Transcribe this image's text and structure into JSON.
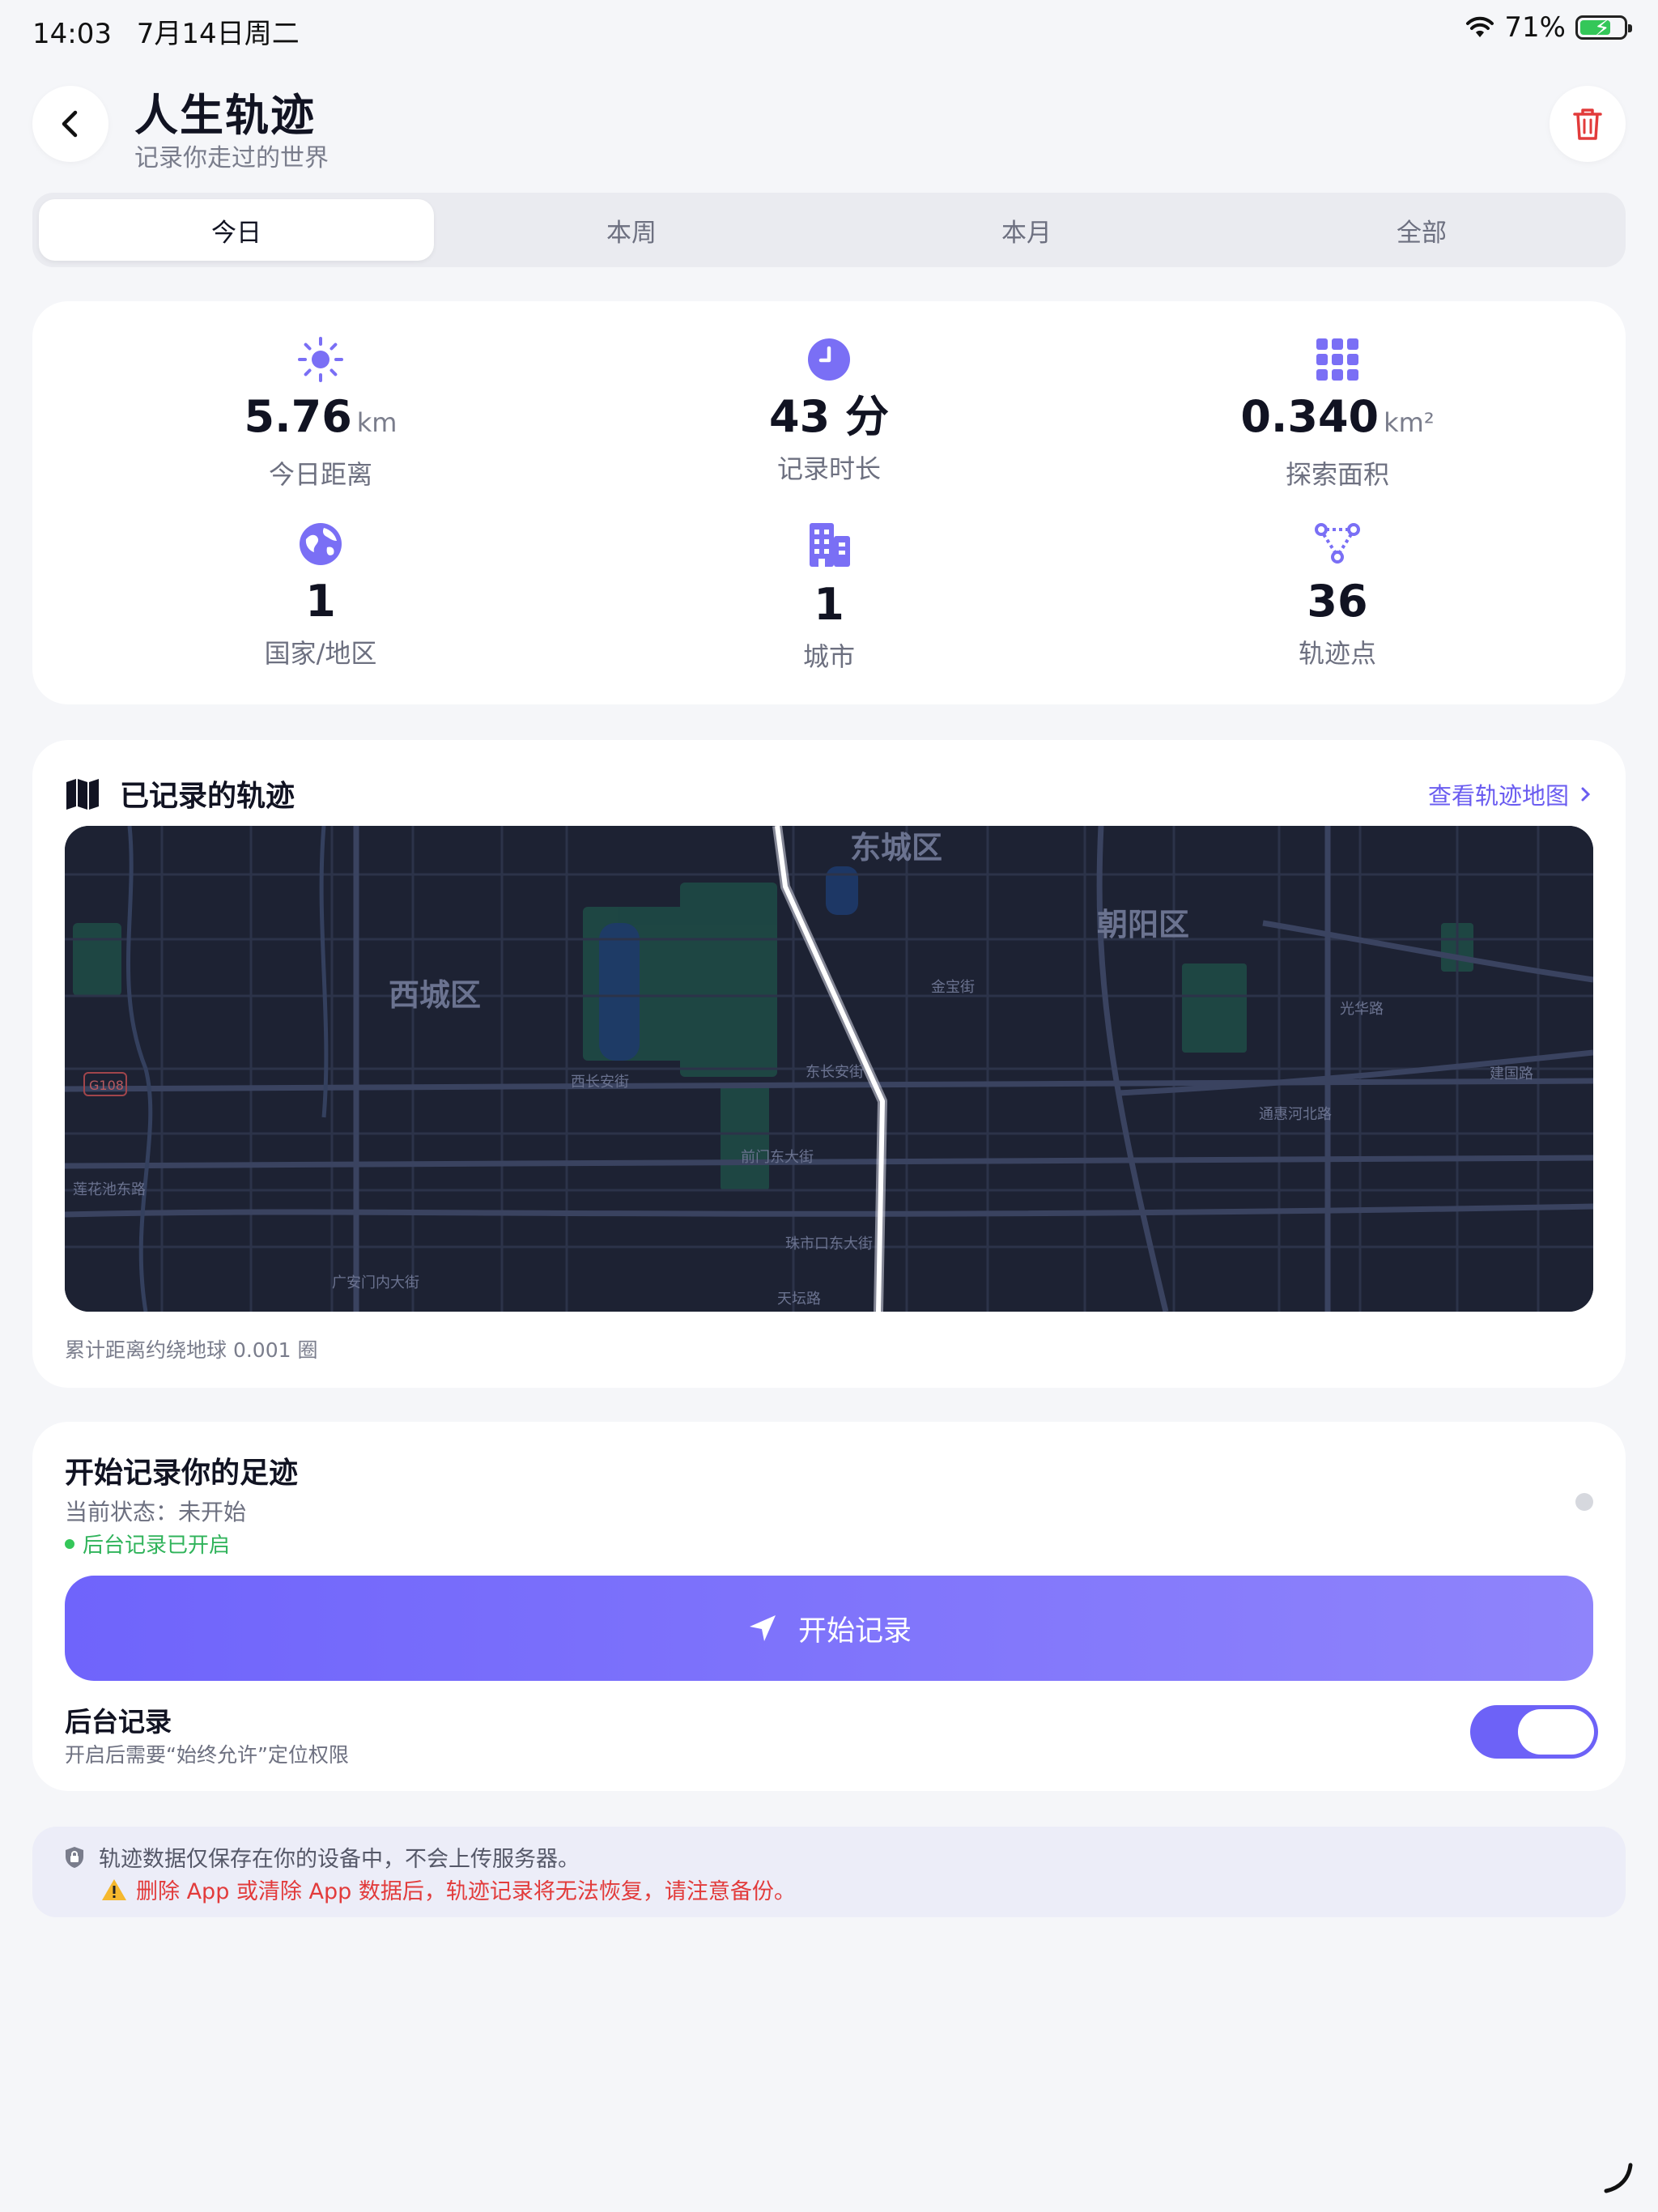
{
  "status_bar": {
    "time": "14:03",
    "date": "7月14日周二",
    "battery": "71%",
    "battery_level": 0.71
  },
  "header": {
    "title": "人生轨迹",
    "subtitle": "记录你走过的世界"
  },
  "tabs": [
    {
      "label": "今日",
      "active": true
    },
    {
      "label": "本周",
      "active": false
    },
    {
      "label": "本月",
      "active": false
    },
    {
      "label": "全部",
      "active": false
    }
  ],
  "stats": [
    {
      "icon": "sun-icon",
      "value": "5.76",
      "unit": "km",
      "label": "今日距离"
    },
    {
      "icon": "clock-icon",
      "value": "43 分",
      "unit": "",
      "label": "记录时长"
    },
    {
      "icon": "grid-icon",
      "value": "0.340",
      "unit": "km²",
      "label": "探索面积"
    },
    {
      "icon": "globe-icon",
      "value": "1",
      "unit": "",
      "label": "国家/地区"
    },
    {
      "icon": "building-icon",
      "value": "1",
      "unit": "",
      "label": "城市"
    },
    {
      "icon": "route-points-icon",
      "value": "36",
      "unit": "",
      "label": "轨迹点"
    }
  ],
  "track": {
    "title": "已记录的轨迹",
    "link": "查看轨迹地图",
    "note": "累计距离约绕地球 0.001 圈",
    "map_labels": {
      "district_dongcheng": "东城区",
      "district_xicheng": "西城区",
      "district_chaoyang": "朝阳区",
      "road_1": "西长安街",
      "road_2": "东长安街",
      "road_3": "前门东大街",
      "road_4": "珠市口东大街",
      "road_5": "广安门内大街",
      "road_6": "莲花池东路",
      "road_7": "金宝街",
      "road_8": "光华路",
      "road_9": "通惠河北路",
      "road_10": "建国路",
      "road_11": "天坛路",
      "shield": "G108"
    }
  },
  "record": {
    "title": "开始记录你的足迹",
    "status": "当前状态：未开始",
    "background_status": "后台记录已开启",
    "start_button": "开始记录",
    "background_label": "后台记录",
    "background_desc": "开启后需要“始终允许”定位权限",
    "background_enabled": true
  },
  "notice": {
    "line1": "轨迹数据仅保存在你的设备中，不会上传服务器。",
    "line2": "删除 App 或清除 App 数据后，轨迹记录将无法恢复，请注意备份。"
  },
  "colors": {
    "accent": "#6d62f7",
    "danger": "#e23b3b",
    "success": "#34c759",
    "map_bg": "#1d2233"
  }
}
